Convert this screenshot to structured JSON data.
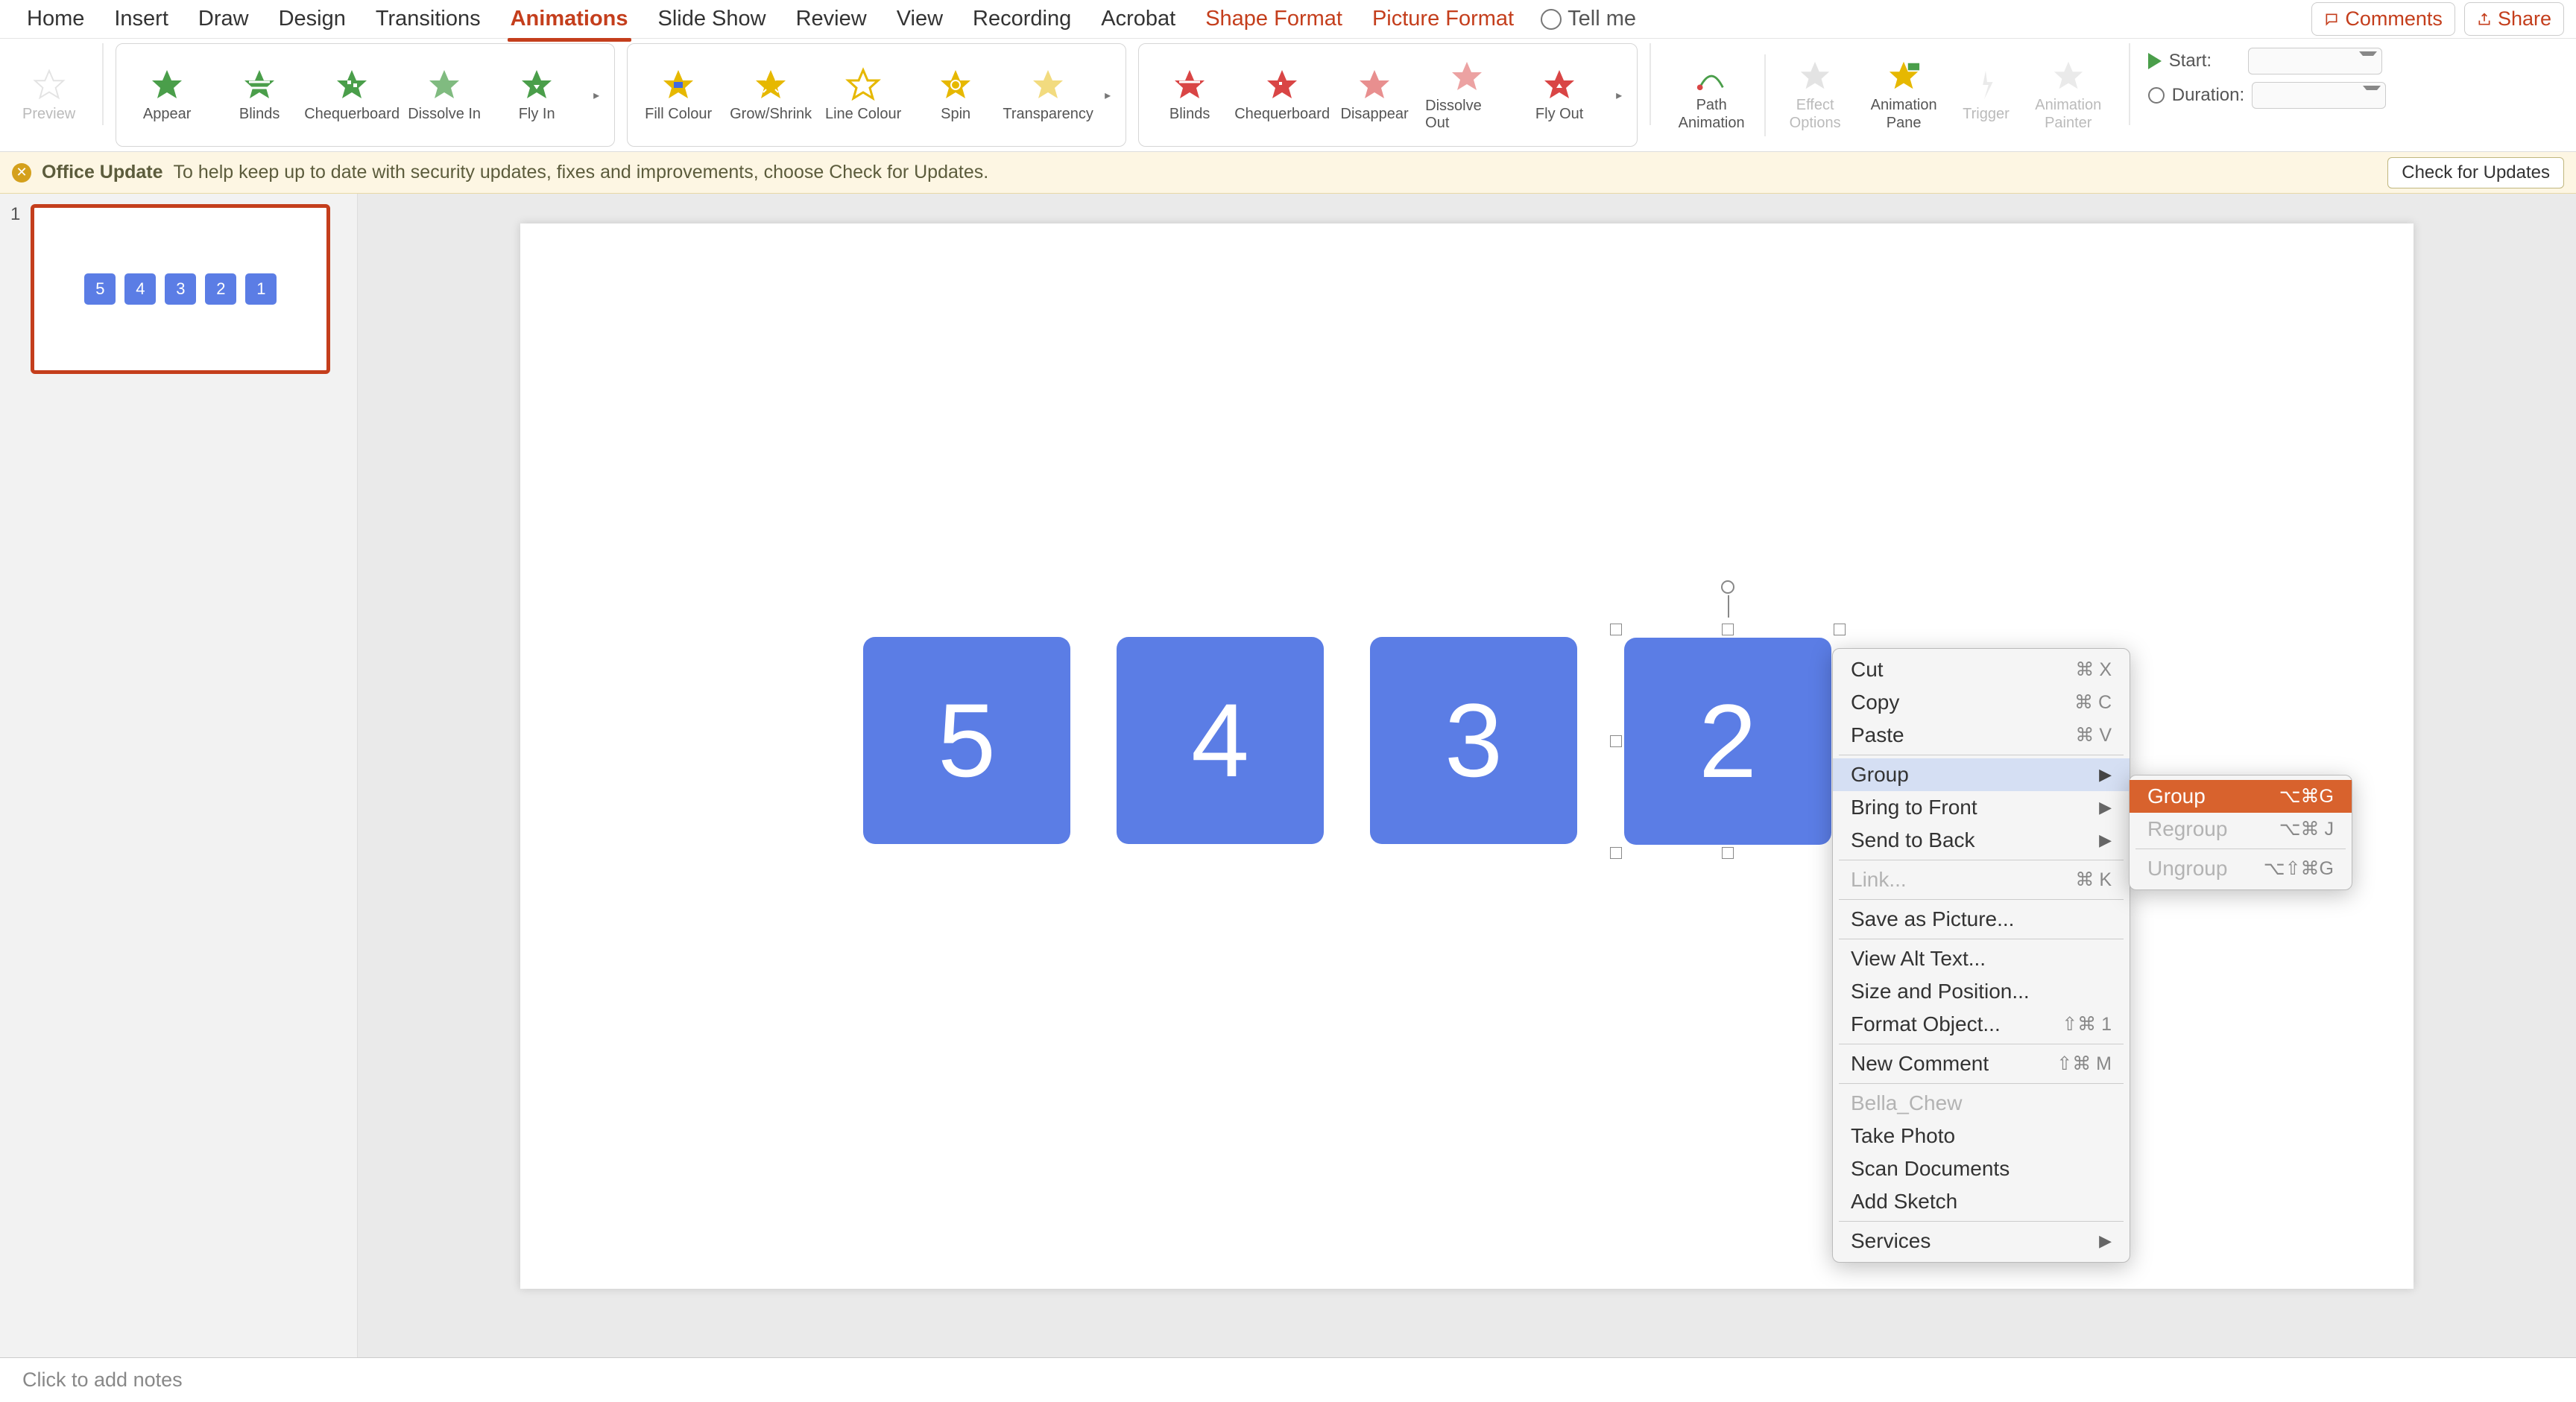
{
  "tabs": {
    "home": "Home",
    "insert": "Insert",
    "draw": "Draw",
    "design": "Design",
    "transitions": "Transitions",
    "animations": "Animations",
    "slide_show": "Slide Show",
    "review": "Review",
    "view": "View",
    "recording": "Recording",
    "acrobat": "Acrobat",
    "shape_format": "Shape Format",
    "picture_format": "Picture Format",
    "tell_me": "Tell me"
  },
  "topbar": {
    "comments": "Comments",
    "share": "Share"
  },
  "ribbon": {
    "preview": "Preview",
    "entrance": {
      "appear": "Appear",
      "blinds": "Blinds",
      "chequerboard": "Chequerboard",
      "dissolve_in": "Dissolve In",
      "fly_in": "Fly In"
    },
    "emphasis": {
      "fill_colour": "Fill Colour",
      "grow_shrink": "Grow/Shrink",
      "line_colour": "Line Colour",
      "spin": "Spin",
      "transparency": "Transparency"
    },
    "exit": {
      "blinds": "Blinds",
      "chequerboard": "Chequerboard",
      "disappear": "Disappear",
      "dissolve_out": "Dissolve Out",
      "fly_out": "Fly Out"
    },
    "path_animation": "Path Animation",
    "effect_options": "Effect Options",
    "animation_pane": "Animation Pane",
    "trigger": "Trigger",
    "animation_painter": "Animation Painter",
    "start": "Start:",
    "duration": "Duration:"
  },
  "notification": {
    "title": "Office Update",
    "message": "To help keep up to date with security updates, fixes and improvements, choose Check for Updates.",
    "button": "Check for Updates"
  },
  "slide": {
    "number": "1",
    "thumbs": [
      "5",
      "4",
      "3",
      "2",
      "1"
    ],
    "shapes": [
      "5",
      "4",
      "3",
      "2"
    ]
  },
  "context_menu": {
    "cut": "Cut",
    "cut_sc": "⌘ X",
    "copy": "Copy",
    "copy_sc": "⌘ C",
    "paste": "Paste",
    "paste_sc": "⌘ V",
    "group": "Group",
    "bring_front": "Bring to Front",
    "send_back": "Send to Back",
    "link": "Link...",
    "link_sc": "⌘ K",
    "save_pic": "Save as Picture...",
    "alt_text": "View Alt Text...",
    "size_pos": "Size and Position...",
    "format_obj": "Format Object...",
    "format_obj_sc": "⇧⌘ 1",
    "new_comment": "New Comment",
    "new_comment_sc": "⇧⌘ M",
    "bella": "Bella_Chew",
    "take_photo": "Take Photo",
    "scan_docs": "Scan Documents",
    "add_sketch": "Add Sketch",
    "services": "Services"
  },
  "submenu": {
    "group": "Group",
    "group_sc": "⌥⌘G",
    "regroup": "Regroup",
    "regroup_sc": "⌥⌘ J",
    "ungroup": "Ungroup",
    "ungroup_sc": "⌥⇧⌘G"
  },
  "notes": "Click to add notes"
}
